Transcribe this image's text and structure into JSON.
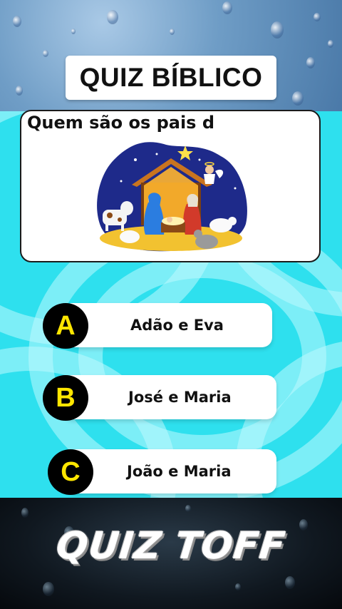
{
  "header": {
    "title": "QUIZ BÍBLICO"
  },
  "question": {
    "text": "Quem são os pais d",
    "image": "nativity-scene"
  },
  "answers": [
    {
      "letter": "A",
      "text": "Adão e Eva"
    },
    {
      "letter": "B",
      "text": "José e Maria"
    },
    {
      "letter": "C",
      "text": "João e Maria"
    }
  ],
  "footer": {
    "brand": "QUIZ TOFF"
  },
  "colors": {
    "accent_bg": "#2ee0ee",
    "badge_letter": "#ffe600",
    "badge_bg": "#000000",
    "card_bg": "#ffffff"
  }
}
